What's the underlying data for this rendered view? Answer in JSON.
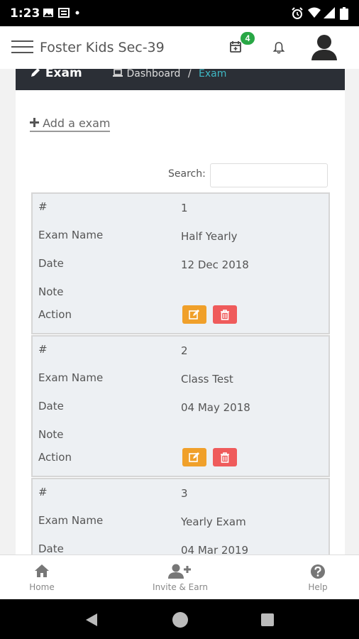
{
  "status_bar": {
    "time": "1:23",
    "icons": [
      "image-icon",
      "news-icon",
      "dot-icon",
      "alarm-icon",
      "wifi-icon",
      "signal-icon",
      "battery-icon"
    ]
  },
  "app_bar": {
    "title": "Foster Kids Sec-39",
    "calendar_badge": "4",
    "icons": [
      "menu-icon",
      "calendar-icon",
      "bell-icon",
      "avatar-icon"
    ]
  },
  "page": {
    "title": "Exam",
    "breadcrumb": {
      "home": "Dashboard",
      "separator": "/",
      "current": "Exam"
    },
    "add_link": "Add a exam",
    "search_label": "Search:",
    "search_placeholder": ""
  },
  "table": {
    "labels": {
      "index": "#",
      "name": "Exam Name",
      "date": "Date",
      "note": "Note",
      "action": "Action"
    },
    "rows": [
      {
        "index": "1",
        "name": "Half Yearly",
        "date": "12 Dec 2018",
        "note": ""
      },
      {
        "index": "2",
        "name": "Class Test",
        "date": "04 May 2018",
        "note": ""
      },
      {
        "index": "3",
        "name": "Yearly Exam",
        "date": "04 Mar 2019",
        "note": ""
      }
    ]
  },
  "bottom_nav": {
    "items": [
      {
        "label": "Home",
        "icon": "home-icon"
      },
      {
        "label": "Invite & Earn",
        "icon": "add-user-icon"
      },
      {
        "label": "Help",
        "icon": "help-icon"
      }
    ]
  },
  "colors": {
    "panel_header": "#2b2f36",
    "breadcrumb_active": "#3fb8c4",
    "badge": "#28a745",
    "edit_button": "#f0a02a",
    "delete_button": "#ef5b5b",
    "card_background": "#edf0f3"
  }
}
